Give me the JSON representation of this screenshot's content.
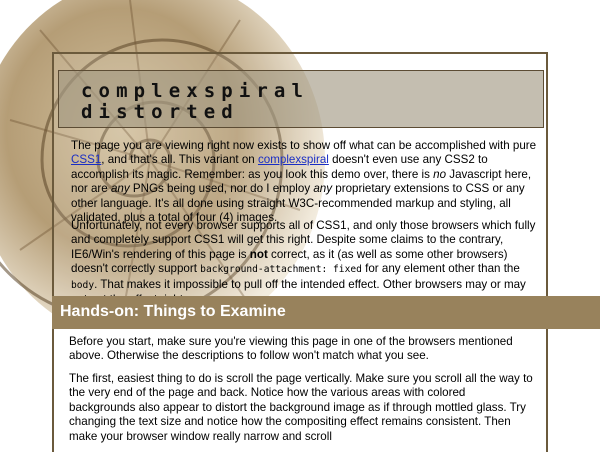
{
  "page": {
    "title_line_1": "complexspiral",
    "title_line_2": "distorted",
    "colors": {
      "section_bar": "#98825c",
      "masthead": "#a09680",
      "border": "#6b5a3c",
      "link": "#1a2ec4"
    }
  },
  "intro": {
    "t1": "The page you are viewing right now exists to show off what can be accomplished with pure ",
    "link_css1": "CSS1",
    "t2": ", and that's all. This variant on ",
    "link_complexspiral": "complexspiral",
    "t3": " doesn't even use any CSS2 to accomplish its magic. Remember: as you look this demo over, there is ",
    "em_no": "no",
    "t4": " Javascript here, nor are ",
    "em_any1": "any",
    "t5": " PNGs being used, nor do I employ ",
    "em_any2": "any",
    "t6": " proprietary extensions to CSS or any other language. It's all done using straight W3C-recommended markup and styling, all validated, plus a total of four (4) images."
  },
  "support": {
    "t1": "Unfortunately, not every browser supports all of CSS1, and only those browsers which fully and completely support CSS1 will get this right. Despite some claims to the contrary, IE6/Win's rendering of this page is ",
    "strong_not": "not",
    "t2": " correct, as it (as well as some other browsers) doesn't correctly support ",
    "code_bg": "background-attachment: fixed",
    "t3": " for any element other than the ",
    "code_body": "body",
    "t4": ". That makes it impossible to pull off the intended effect. Other browsers may or may not get the effect right."
  },
  "section": {
    "heading": "Hands-on: Things to Examine"
  },
  "before": {
    "text": "Before you start, make sure you're viewing this page in one of the browsers mentioned above. Otherwise the descriptions to follow won't match what you see."
  },
  "first": {
    "text": "The first, easiest thing to do is scroll the page vertically. Make sure you scroll all the way to the very end of the page and back. Notice how the various areas with colored backgrounds also appear to distort the background image as if through mottled glass. Try changing the text size and notice how the compositing effect remains consistent. Then make your browser window really narrow and scroll"
  }
}
